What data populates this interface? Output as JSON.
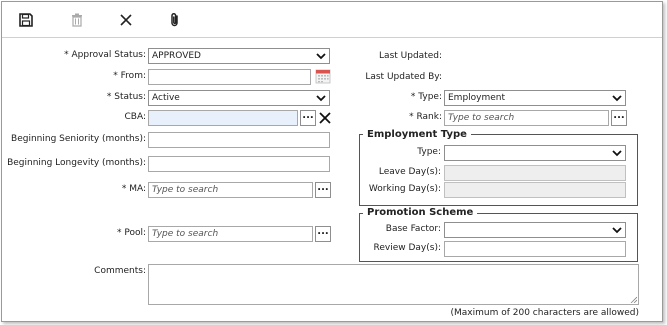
{
  "toolbar": {
    "save_icon": "floppy-disk-icon",
    "delete_icon": "trash-icon",
    "close_icon": "close-x-icon",
    "attach_icon": "paperclip-icon"
  },
  "form": {
    "approval_status": {
      "label": "* Approval Status:",
      "value": "APPROVED"
    },
    "from": {
      "label": "* From:",
      "value": ""
    },
    "status": {
      "label": "* Status:",
      "value": "Active"
    },
    "cba": {
      "label": "CBA:",
      "value": ""
    },
    "beginning_seniority": {
      "label": "Beginning Seniority (months):",
      "value": ""
    },
    "beginning_longevity": {
      "label": "Beginning Longevity (months):",
      "value": ""
    },
    "ma": {
      "label": "* MA:",
      "placeholder": "Type to search"
    },
    "pool": {
      "label": "* Pool:",
      "placeholder": "Type to search"
    },
    "comments": {
      "label": "Comments:",
      "value": "",
      "hint": "(Maximum of 200 characters are allowed)"
    }
  },
  "right": {
    "last_updated": {
      "label": "Last Updated:",
      "value": ""
    },
    "last_updated_by": {
      "label": "Last Updated By:",
      "value": ""
    },
    "type": {
      "label": "* Type:",
      "value": "Employment"
    },
    "rank": {
      "label": "* Rank:",
      "placeholder": "Type to search"
    },
    "employment_type": {
      "title": "Employment Type",
      "type": {
        "label": "Type:",
        "value": ""
      },
      "leave_days": {
        "label": "Leave Day(s):",
        "value": ""
      },
      "working_days": {
        "label": "Working Day(s):",
        "value": ""
      }
    },
    "promotion_scheme": {
      "title": "Promotion Scheme",
      "base_factor": {
        "label": "Base Factor:",
        "value": ""
      },
      "review_days": {
        "label": "Review Day(s):",
        "value": ""
      }
    }
  },
  "buttons": {
    "lookup_label": "...",
    "clear_icon": "clear-x-icon"
  },
  "colors": {
    "accent_calendar": "#d9534f",
    "highlight_input": "#e8f0fb"
  }
}
